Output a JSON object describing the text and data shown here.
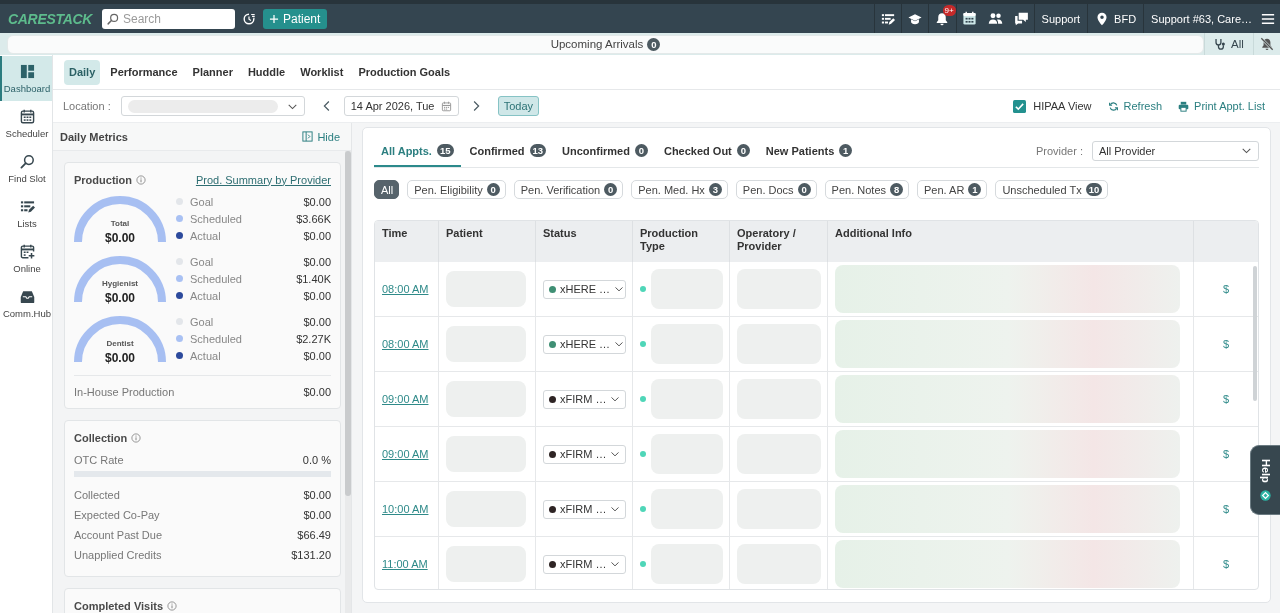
{
  "top_bar": {
    "logo": "CARESTACK",
    "search": {
      "placeholder": "Search"
    },
    "add_patient_button": "Patient",
    "notification_badge": "9+",
    "support_link": "Support",
    "location": "BFD",
    "user_menu": "Support #63, Care…"
  },
  "arrivals_bar": {
    "label": "Upcoming Arrivals",
    "count": "0",
    "filter": "All"
  },
  "nav": [
    {
      "label": "Dashboard",
      "selected": true
    },
    {
      "label": "Scheduler",
      "selected": false
    },
    {
      "label": "Find Slot",
      "selected": false
    },
    {
      "label": "Lists",
      "selected": false
    },
    {
      "label": "Online",
      "selected": false
    },
    {
      "label": "Comm.Hub",
      "selected": false
    }
  ],
  "dashboard_tabs": [
    {
      "label": "Daily",
      "selected": true
    },
    {
      "label": "Performance",
      "selected": false
    },
    {
      "label": "Planner",
      "selected": false
    },
    {
      "label": "Huddle",
      "selected": false
    },
    {
      "label": "Worklist",
      "selected": false
    },
    {
      "label": "Production Goals",
      "selected": false
    }
  ],
  "toolbar": {
    "location_label": "Location :",
    "date": "14 Apr 2026, Tue",
    "today_button": "Today",
    "hipaa_view": {
      "label": "HIPAA View",
      "checked": true
    },
    "refresh_button": "Refresh",
    "print_button": "Print Appt. List"
  },
  "daily_metrics": {
    "title": "Daily Metrics",
    "hide_button": "Hide",
    "production": {
      "title": "Production",
      "link": "Prod. Summary by Provider",
      "gauges": [
        {
          "label": "Total",
          "value": "$0.00",
          "legend": [
            {
              "label": "Goal",
              "value": "$0.00",
              "color": "#e3e6ea"
            },
            {
              "label": "Scheduled",
              "value": "$3.66K",
              "color": "#a9c1f3"
            },
            {
              "label": "Actual",
              "value": "$0.00",
              "color": "#2c4a9c"
            }
          ]
        },
        {
          "label": "Hygienist",
          "value": "$0.00",
          "legend": [
            {
              "label": "Goal",
              "value": "$0.00",
              "color": "#e3e6ea"
            },
            {
              "label": "Scheduled",
              "value": "$1.40K",
              "color": "#a9c1f3"
            },
            {
              "label": "Actual",
              "value": "$0.00",
              "color": "#2c4a9c"
            }
          ]
        },
        {
          "label": "Dentist",
          "value": "$0.00",
          "legend": [
            {
              "label": "Goal",
              "value": "$0.00",
              "color": "#e3e6ea"
            },
            {
              "label": "Scheduled",
              "value": "$2.27K",
              "color": "#a9c1f3"
            },
            {
              "label": "Actual",
              "value": "$0.00",
              "color": "#2c4a9c"
            }
          ]
        }
      ],
      "in_house": {
        "label": "In-House Production",
        "value": "$0.00"
      }
    },
    "collection": {
      "title": "Collection",
      "otc_rate": {
        "label": "OTC Rate",
        "value": "0.0 %",
        "level": 0
      },
      "rows": [
        {
          "label": "Collected",
          "value": "$0.00"
        },
        {
          "label": "Expected Co-Pay",
          "value": "$0.00"
        },
        {
          "label": "Account Past Due",
          "value": "$66.49"
        },
        {
          "label": "Unapplied Credits",
          "value": "$131.20"
        }
      ]
    },
    "completed_visits": {
      "title": "Completed Visits"
    }
  },
  "appointments": {
    "tabs": [
      {
        "label": "All Appts.",
        "count": "15",
        "selected": true
      },
      {
        "label": "Confirmed",
        "count": "13",
        "selected": false
      },
      {
        "label": "Unconfirmed",
        "count": "0",
        "selected": false
      },
      {
        "label": "Checked Out",
        "count": "0",
        "selected": false
      },
      {
        "label": "New Patients",
        "count": "1",
        "selected": false
      }
    ],
    "provider": {
      "label": "Provider :",
      "value": "All Provider"
    },
    "filters": [
      {
        "label": "All",
        "selected": true
      },
      {
        "label": "Pen. Eligibility",
        "count": "0",
        "selected": false
      },
      {
        "label": "Pen. Verification",
        "count": "0",
        "selected": false
      },
      {
        "label": "Pen. Med. Hx",
        "count": "3",
        "selected": false
      },
      {
        "label": "Pen. Docs",
        "count": "0",
        "selected": false
      },
      {
        "label": "Pen. Notes",
        "count": "8",
        "selected": false
      },
      {
        "label": "Pen. AR",
        "count": "1",
        "selected": false
      },
      {
        "label": "Unscheduled Tx",
        "count": "10",
        "selected": false
      }
    ],
    "table": {
      "columns": [
        "Time",
        "Patient",
        "Status",
        "Production Type",
        "Operatory / Provider",
        "Additional Info"
      ],
      "rows": [
        {
          "time": "08:00 AM",
          "status": {
            "label": "xHERE …",
            "color": "#3f8f74"
          },
          "column_7": "$"
        },
        {
          "time": "08:00 AM",
          "status": {
            "label": "xHERE …",
            "color": "#3f8f74"
          },
          "column_7": "$"
        },
        {
          "time": "09:00 AM",
          "status": {
            "label": "xFIRM …",
            "color": "#2e2424"
          },
          "column_7": "$"
        },
        {
          "time": "09:00 AM",
          "status": {
            "label": "xFIRM …",
            "color": "#2e2424"
          },
          "column_7": "$"
        },
        {
          "time": "10:00 AM",
          "status": {
            "label": "xFIRM …",
            "color": "#2e2424"
          },
          "column_7": "$"
        },
        {
          "time": "11:00 AM",
          "status": {
            "label": "xFIRM …",
            "color": "#2e2424"
          },
          "column_7": "$"
        }
      ]
    }
  },
  "help_tab": {
    "label": "Help"
  }
}
